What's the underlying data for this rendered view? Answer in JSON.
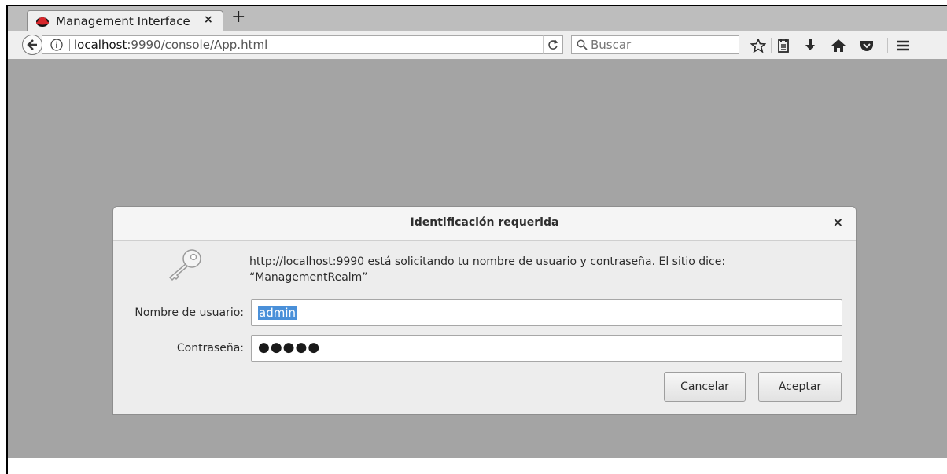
{
  "browser": {
    "tab": {
      "title": "Management Interface",
      "close_label": "×",
      "favicon": "redhat-icon"
    },
    "new_tab_label": "+",
    "url": {
      "host": "localhost",
      "rest": ":9990/console/App.html"
    },
    "search": {
      "placeholder": "Buscar"
    },
    "toolbar_icons": [
      "bookmark-star-icon",
      "reading-list-icon",
      "downloads-icon",
      "home-icon",
      "pocket-icon",
      "menu-icon"
    ]
  },
  "dialog": {
    "title": "Identificación requerida",
    "close_label": "×",
    "message_line1": "http://localhost:9990 está solicitando tu nombre de usuario y contraseña. El sitio dice:",
    "message_line2": "“ManagementRealm”",
    "username_label": "Nombre de usuario:",
    "username_value": "admin",
    "password_label": "Contraseña:",
    "password_value": "●●●●●",
    "cancel_label": "Cancelar",
    "accept_label": "Aceptar"
  },
  "colors": {
    "content_bg": "#a4a4a4",
    "selection": "#4a90d9"
  }
}
